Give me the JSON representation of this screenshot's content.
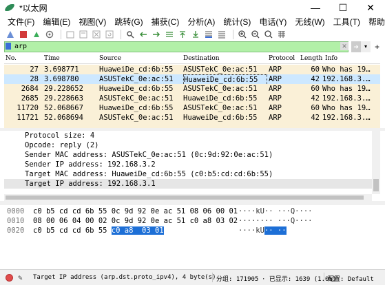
{
  "window": {
    "title": "*以太网"
  },
  "menu": [
    "文件(F)",
    "编辑(E)",
    "视图(V)",
    "跳转(G)",
    "捕获(C)",
    "分析(A)",
    "统计(S)",
    "电话(Y)",
    "无线(W)",
    "工具(T)",
    "帮助(H)"
  ],
  "filter": {
    "value": "arp"
  },
  "columns": [
    "No.",
    "Time",
    "Source",
    "Destination",
    "Protocol",
    "Length",
    "Info"
  ],
  "packets": [
    {
      "no": "27",
      "time": "3.698771",
      "src": "HuaweiDe_cd:6b:55",
      "dst": "ASUSTekC_0e:ac:51",
      "proto": "ARP",
      "len": "60",
      "info": "Who has 19…"
    },
    {
      "no": "28",
      "time": "3.698780",
      "src": "ASUSTekC_0e:ac:51",
      "dst": "HuaweiDe_cd:6b:55",
      "proto": "ARP",
      "len": "42",
      "info": "192.168.3.…"
    },
    {
      "no": "2684",
      "time": "29.228652",
      "src": "HuaweiDe_cd:6b:55",
      "dst": "ASUSTekC_0e:ac:51",
      "proto": "ARP",
      "len": "60",
      "info": "Who has 19…"
    },
    {
      "no": "2685",
      "time": "29.228663",
      "src": "ASUSTekC_0e:ac:51",
      "dst": "HuaweiDe_cd:6b:55",
      "proto": "ARP",
      "len": "42",
      "info": "192.168.3.…"
    },
    {
      "no": "11720",
      "time": "52.068667",
      "src": "HuaweiDe_cd:6b:55",
      "dst": "ASUSTekC_0e:ac:51",
      "proto": "ARP",
      "len": "60",
      "info": "Who has 19…"
    },
    {
      "no": "11721",
      "time": "52.068694",
      "src": "ASUSTekC_0e:ac:51",
      "dst": "HuaweiDe_cd:6b:55",
      "proto": "ARP",
      "len": "42",
      "info": "192.168.3.…"
    }
  ],
  "details": [
    "Protocol size: 4",
    "Opcode: reply (2)",
    "Sender MAC address: ASUSTekC_0e:ac:51 (0c:9d:92:0e:ac:51)",
    "Sender IP address: 192.168.3.2",
    "Target MAC address: HuaweiDe_cd:6b:55 (c0:b5:cd:cd:6b:55)",
    "Target IP address: 192.168.3.1"
  ],
  "bytes": [
    {
      "offset": "0000",
      "hex": "c0 b5 cd cd 6b 55 0c 9d  92 0e ac 51 08 06 00 01",
      "ascii": "····kU·· ···Q····"
    },
    {
      "offset": "0010",
      "hex": "08 00 06 04 00 02 0c 9d  92 0e ac 51 c0 a8 03 02",
      "ascii": "········ ···Q····"
    },
    {
      "offset": "0020",
      "hex_plain": "c0 b5 cd cd 6b 55 ",
      "hex_hl": "c0 a8  03 01",
      "ascii_plain": "····kU",
      "ascii_hl": "·· ··"
    }
  ],
  "status": {
    "field": "Target IP address (arp.dst.proto_ipv4), 4 byte(s)",
    "groups": "分组: 171905",
    "shown": "· 已显示: 1639 (1.0%)",
    "profile": "配置: Default"
  },
  "colors": {
    "row_bg": "#faf0d7",
    "selected_row": "#cde8ff",
    "filter_bg": "#b2f0a8",
    "highlight": "#1d6fd6"
  }
}
